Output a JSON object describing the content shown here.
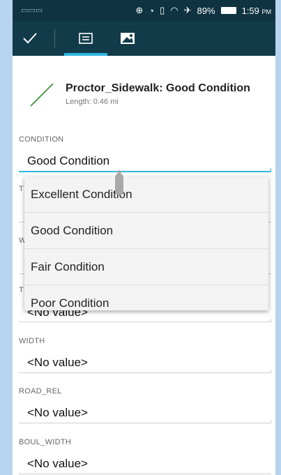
{
  "status_bar": {
    "keyboard_icon": "keyboard-icon",
    "icons": [
      "gps-icon",
      "nfc-icon",
      "vibrate-icon",
      "wifi-icon",
      "airplane-icon"
    ],
    "battery": "89%",
    "time": "1:59",
    "ampm": "PM"
  },
  "toolbar": {
    "done_icon": "checkmark-icon",
    "tabs": [
      "form-icon",
      "photo-icon"
    ],
    "accent_color": "#31b7df"
  },
  "feature": {
    "title": "Proctor_Sidewalk: Good Condition",
    "length": "Length: 0.46 mi"
  },
  "fields": [
    {
      "label": "CONDITION",
      "value": "Good Condition"
    },
    {
      "label": "T",
      "value": ""
    },
    {
      "label": "W",
      "value": ""
    },
    {
      "label": "T",
      "value": "<No value>"
    },
    {
      "label": "WIDTH",
      "value": "<No value>"
    },
    {
      "label": "ROAD_REL",
      "value": "<No value>"
    },
    {
      "label": "BOUL_WIDTH",
      "value": "<No value>"
    }
  ],
  "dropdown": {
    "options": [
      "Excellent Condition",
      "Good Condition",
      "Fair Condition",
      "Poor Condition"
    ]
  }
}
